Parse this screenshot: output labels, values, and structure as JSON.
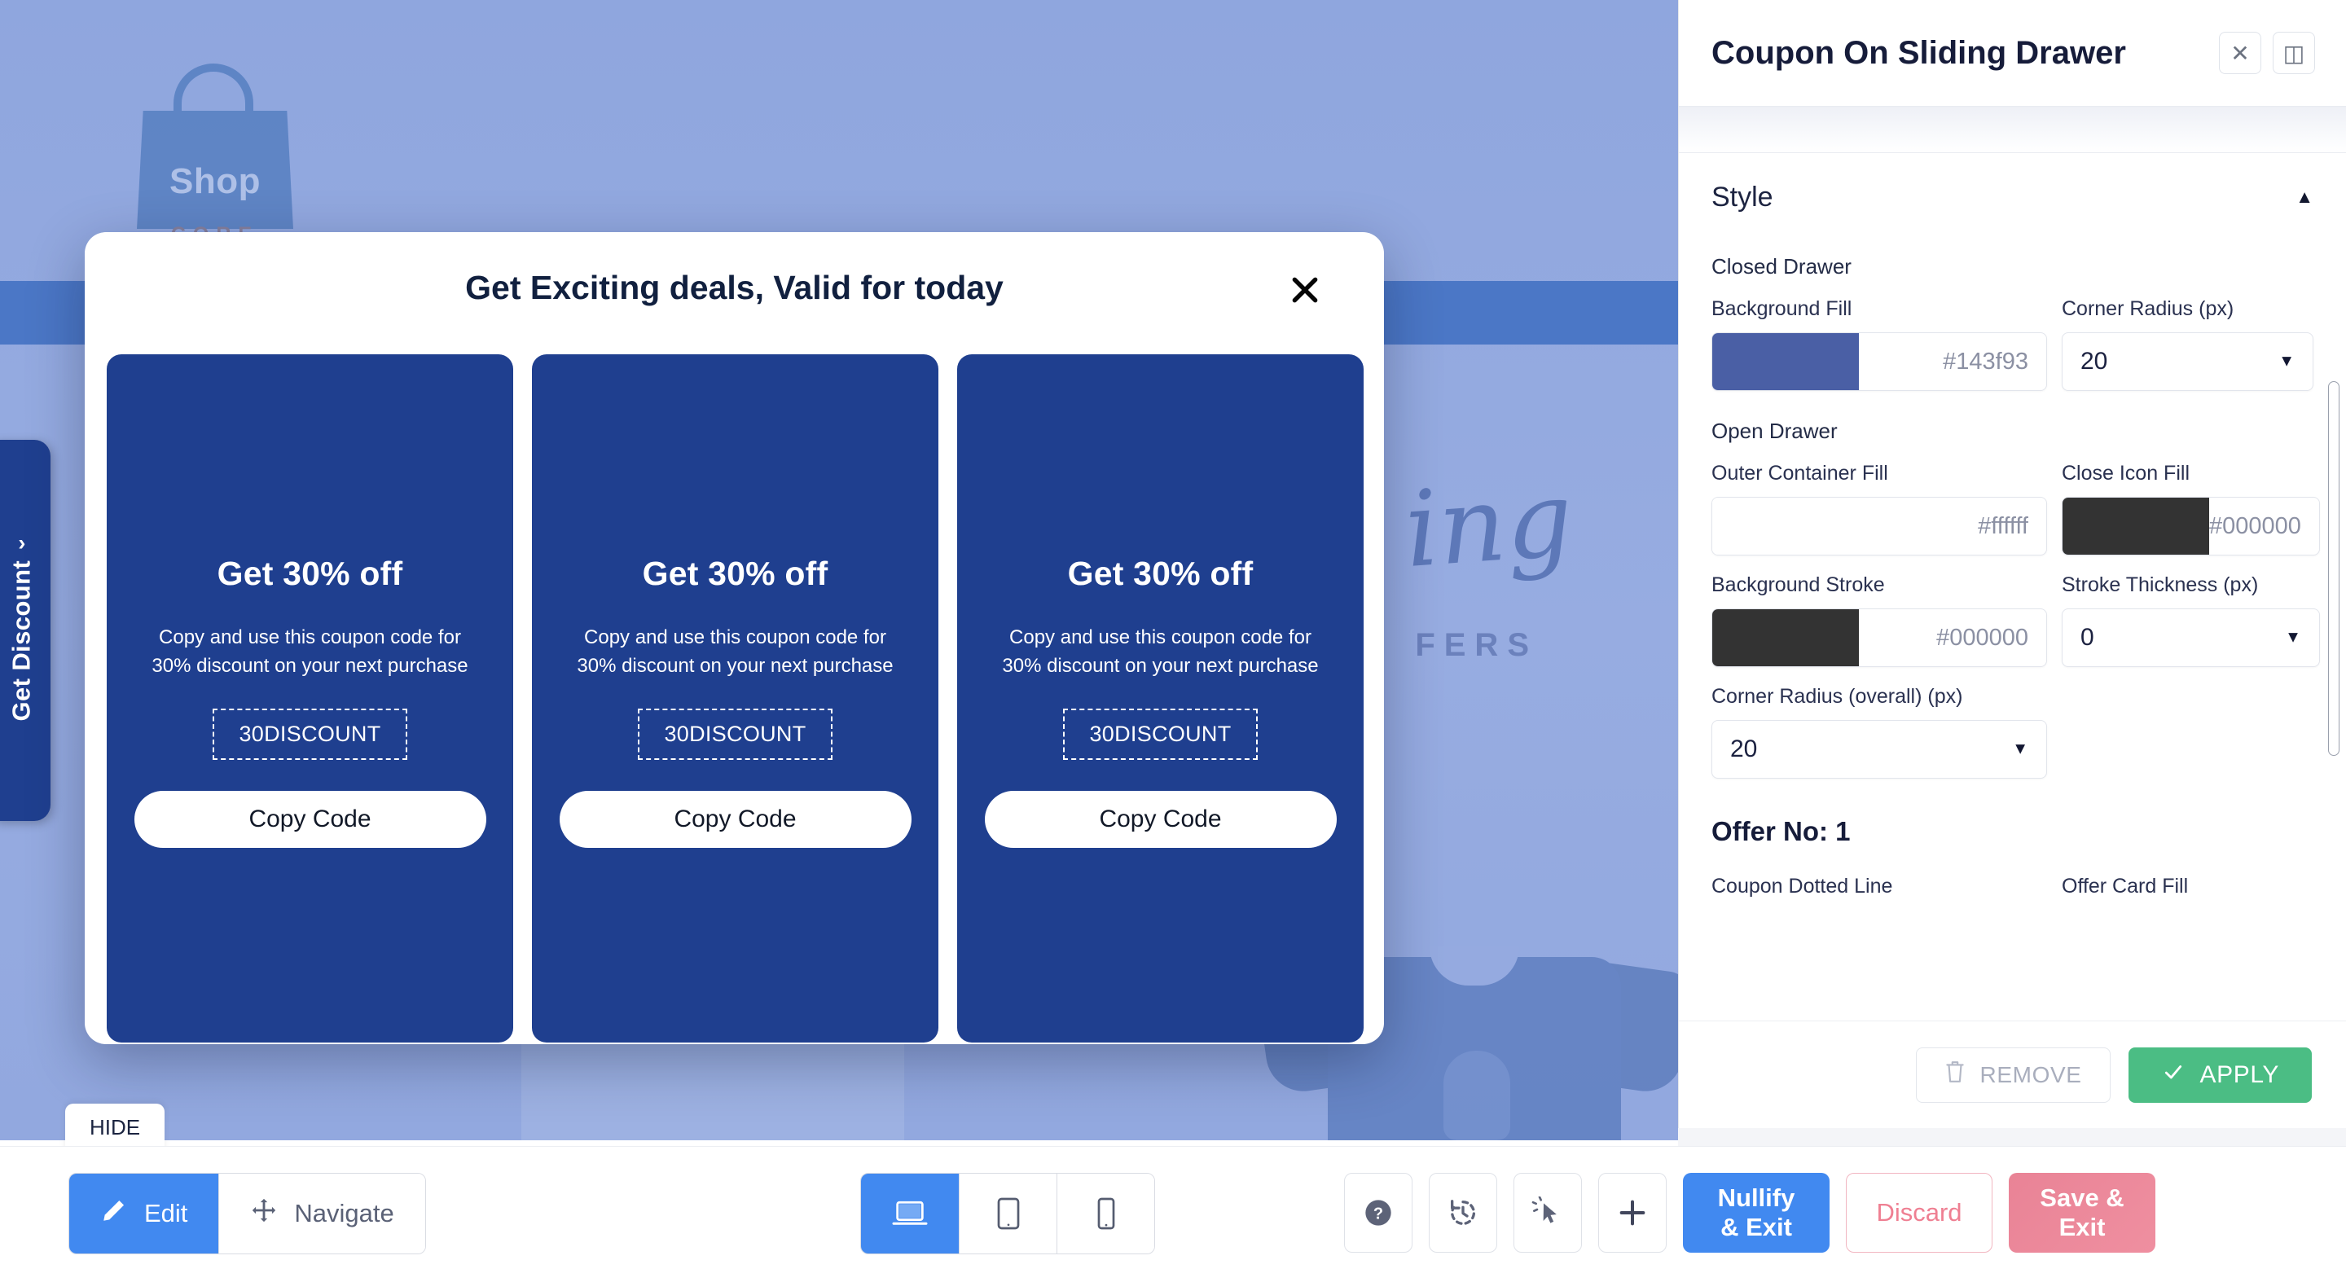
{
  "preview": {
    "logo": {
      "word": "Shop",
      "sub": "CORE"
    },
    "background_script_text": "ing",
    "background_sub_text": "FERS",
    "drawer_tab": {
      "label": "Get Discount",
      "chevron": "›"
    },
    "hide_chip": "HIDE"
  },
  "modal": {
    "title": "Get Exciting deals, Valid for today",
    "close_icon": "close-icon",
    "cards": [
      {
        "title": "Get 30% off",
        "description": "Copy and use this coupon code for 30% discount on your next purchase",
        "code": "30DISCOUNT",
        "button": "Copy Code"
      },
      {
        "title": "Get 30% off",
        "description": "Copy and use this coupon code for 30% discount on your next purchase",
        "code": "30DISCOUNT",
        "button": "Copy Code"
      },
      {
        "title": "Get 30% off",
        "description": "Copy and use this coupon code for 30% discount on your next purchase",
        "code": "30DISCOUNT",
        "button": "Copy Code"
      }
    ]
  },
  "panel": {
    "title": "Coupon On Sliding Drawer",
    "close_label": "✕",
    "dock_label": "◫",
    "accordion": {
      "label": "Style",
      "caret": "▲"
    },
    "closed_drawer": {
      "group_label": "Closed Drawer",
      "background_fill": {
        "label": "Background Fill",
        "value": "#143f93",
        "swatch": "#4a5fa5"
      },
      "corner_radius": {
        "label": "Corner Radius (px)",
        "value": "20",
        "caret": "▼"
      }
    },
    "open_drawer": {
      "group_label": "Open Drawer",
      "outer_container_fill": {
        "label": "Outer Container Fill",
        "value": "#ffffff",
        "swatch": "#ffffff"
      },
      "close_icon_fill": {
        "label": "Close Icon Fill",
        "value": "#000000",
        "swatch": "#333333"
      },
      "background_stroke": {
        "label": "Background Stroke",
        "value": "#000000",
        "swatch": "#333333"
      },
      "stroke_thickness": {
        "label": "Stroke Thickness (px)",
        "value": "0",
        "caret": "▼"
      },
      "corner_radius_overall": {
        "label": "Corner Radius (overall) (px)",
        "value": "20",
        "caret": "▼"
      }
    },
    "offer": {
      "heading": "Offer No: 1",
      "coupon_dotted_line_label": "Coupon Dotted Line",
      "offer_card_fill_label": "Offer Card Fill"
    },
    "footer": {
      "remove_label": "REMOVE",
      "apply_label": "APPLY",
      "remove_icon": "trash-icon",
      "apply_icon": "check-icon"
    }
  },
  "toolbar": {
    "modes": [
      {
        "label": "Edit",
        "icon": "pencil-icon",
        "active": true
      },
      {
        "label": "Navigate",
        "icon": "move-icon",
        "active": false
      }
    ],
    "devices": [
      {
        "icon": "laptop-icon",
        "active": true
      },
      {
        "icon": "tablet-icon",
        "active": false
      },
      {
        "icon": "mobile-icon",
        "active": false
      }
    ],
    "tools": [
      {
        "icon": "help-icon"
      },
      {
        "icon": "history-icon"
      },
      {
        "icon": "cursor-click-icon"
      },
      {
        "icon": "plus-icon"
      }
    ],
    "actions": {
      "nullify": "Nullify\n& Exit",
      "nullify_line1": "Nullify",
      "nullify_line2": "& Exit",
      "discard": "Discard",
      "save_line1": "Save &",
      "save_line2": "Exit"
    }
  },
  "colors": {
    "accent_blue": "#4189f0",
    "card_blue": "#1f3f8f",
    "apply_green": "#4bbd84",
    "save_pink": "#ec8a9b",
    "nav_blue": "#4472c4"
  }
}
